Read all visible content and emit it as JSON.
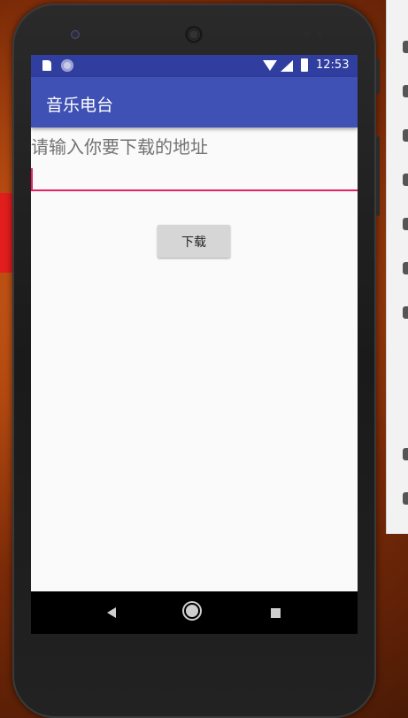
{
  "statusbar": {
    "time": "12:53"
  },
  "appbar": {
    "title": "音乐电台"
  },
  "main": {
    "prompt": "请输入你要下载的地址",
    "url_input": {
      "value": "",
      "placeholder": ""
    },
    "download_label": "下载"
  },
  "navbar": {
    "icons": [
      "back-icon",
      "home-icon",
      "recent-apps-icon"
    ]
  },
  "colors": {
    "statusbar": "#303f9f",
    "appbar": "#3f51b5",
    "accent": "#e91e63",
    "button": "#d6d6d6"
  }
}
